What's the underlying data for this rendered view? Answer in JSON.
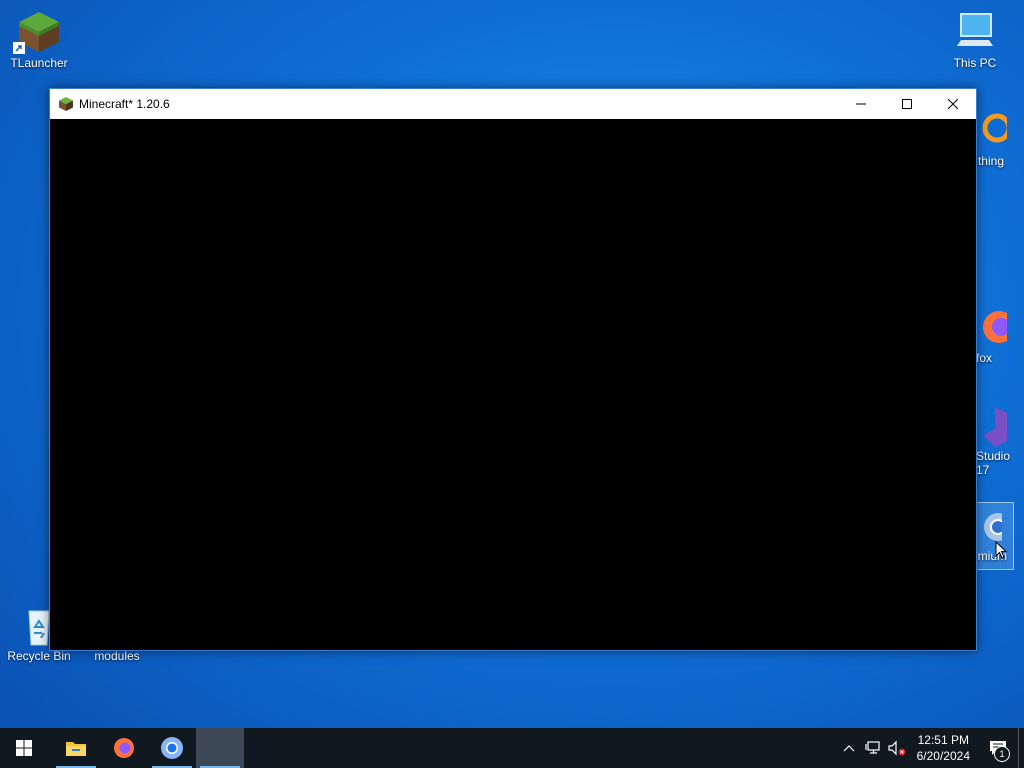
{
  "desktop": {
    "icons_left": [
      {
        "label": "TLauncher"
      },
      {
        "label": "Recycle Bin"
      },
      {
        "label": "modules"
      }
    ],
    "icons_right": [
      {
        "label": "This PC"
      },
      {
        "label": "thing"
      },
      {
        "label": "fox"
      },
      {
        "label_line1": "Studio",
        "label_line2": "17"
      },
      {
        "label": "mium"
      }
    ]
  },
  "window": {
    "title": "Minecraft* 1.20.6"
  },
  "taskbar": {
    "items": [
      "start",
      "file-explorer",
      "firefox",
      "chromium",
      "minecraft"
    ],
    "clock": {
      "time": "12:51 PM",
      "date": "6/20/2024"
    },
    "notifications_count": "1"
  },
  "colors": {
    "accent": "#76b9ed",
    "taskbar": "#101820",
    "window_border": "#3a7bd5"
  }
}
